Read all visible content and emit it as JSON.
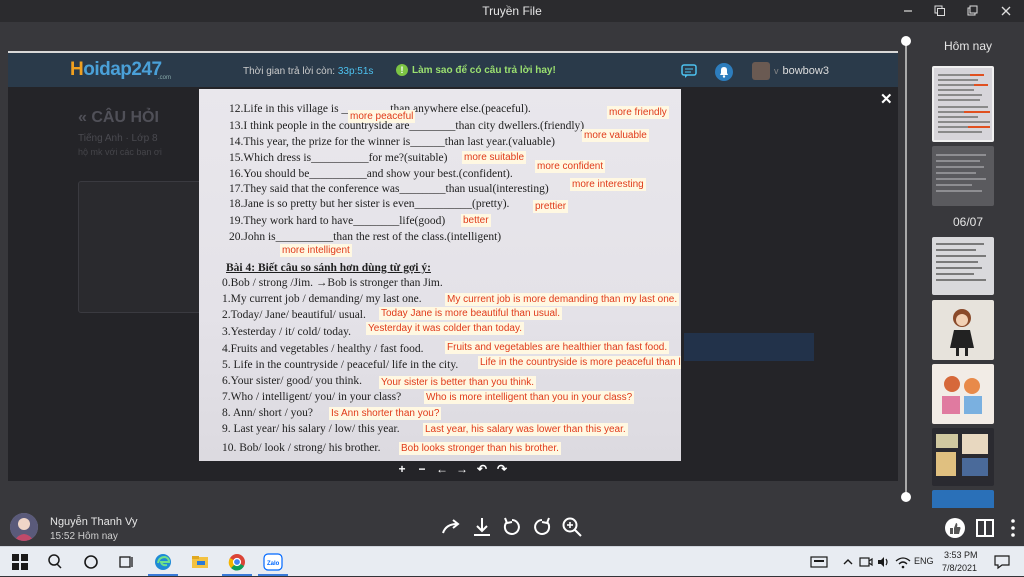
{
  "window": {
    "title": "Truyền File"
  },
  "site": {
    "logo_prefix": "H",
    "logo_rest": "oidap247",
    "logo_sub": ".com",
    "timer_label": "Thời gian trả lời còn:",
    "timer_value": "33p:51s",
    "tip_icon": "!",
    "tip": "Làm sao để có câu trả lời hay!",
    "username": "bowbow3",
    "user_prefix": "v"
  },
  "background_page": {
    "heading": "« CÂU HỎI",
    "subject": "Tiếng Anh · Lớp 8",
    "note": "hộ mk với các bạn ơi"
  },
  "photo_lines": [
    {
      "text": "12.Life in this village is ________ than anywhere else.(peaceful).",
      "answer": "more peaceful"
    },
    {
      "text": "13.I think people in the countryside are________than city dwellers.(friendly)",
      "answer": "more friendly"
    },
    {
      "text": "14.This year, the prize for the winner is______than last year.(valuable)",
      "answer": "more valuable"
    },
    {
      "text": "15.Which dress is__________for me?(suitable)",
      "answer": "more suitable"
    },
    {
      "text": "16.You should be__________and show your best.(confident).",
      "answer": "more confident"
    },
    {
      "text": "17.They said that the conference was________than usual(interesting)",
      "answer": "more interesting"
    },
    {
      "text": "18.Jane is so pretty but her sister is even__________(pretty).",
      "answer": "prettier"
    },
    {
      "text": "19.They work hard to have________life(good)",
      "answer": "better"
    },
    {
      "text": "20.John is__________than the rest of the class.(intelligent)",
      "answer": "more intelligent"
    }
  ],
  "section_title": "Bài 4: Biết câu so sánh hơn dùng từ gợi ý:",
  "example_line": "0.Bob / strong /Jim. →Bob is stronger than Jim.",
  "exercise_lines": [
    {
      "text": "1.My current job / demanding/ my last one.",
      "answer": "My current job is more demanding than my last one."
    },
    {
      "text": "2.Today/ Jane/ beautiful/ usual.",
      "answer": "Today Jane is more beautiful than usual."
    },
    {
      "text": "3.Yesterday / it/ cold/ today.",
      "answer": "Yesterday it was colder than today."
    },
    {
      "text": "4.Fruits and vegetables / healthy / fast food.",
      "answer": "Fruits and vegetables are healthier than fast food."
    },
    {
      "text": "5. Life in the countryside / peaceful/ life in the city.",
      "answer": "Life in the countryside is more peaceful than life in the city"
    },
    {
      "text": "6.Your sister/ good/ you think.",
      "answer": "Your sister is better than you think."
    },
    {
      "text": "7.Who / intelligent/ you/ in your class?",
      "answer": "Who is more intelligent than you in your class?"
    },
    {
      "text": "8. Ann/ short / you?",
      "answer": "Is Ann shorter than you?"
    },
    {
      "text": "9. Last year/ his salary / low/ this year.",
      "answer": "Last year, his salary was lower than this year."
    },
    {
      "text": "10. Bob/ look / strong/ his brother.",
      "answer": "Bob looks stronger than his brother."
    }
  ],
  "zoom_tools": [
    "+",
    "−",
    "←",
    "→",
    "↶",
    "↷"
  ],
  "sidebar": {
    "today_label": "Hôm nay",
    "date_label": "06/07"
  },
  "sender": {
    "name": "Nguyễn Thanh Vy",
    "time": "15:52 Hôm nay"
  },
  "taskbar": {
    "lang": "ENG",
    "time": "3:53 PM",
    "date": "7/8/2021"
  },
  "colors": {
    "answer": "#e03a1a",
    "accent": "#4dc2f0",
    "tip": "#9be070"
  }
}
